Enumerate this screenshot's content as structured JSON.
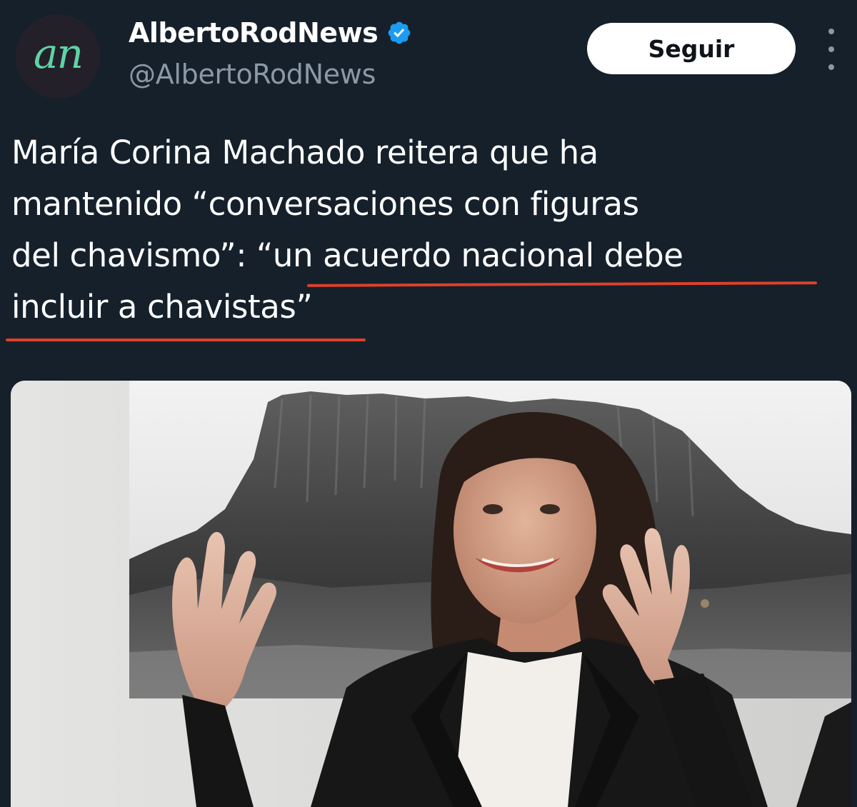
{
  "tweet": {
    "account": {
      "avatar_text": "an",
      "display_name": "AlbertoRodNews",
      "handle": "@AlbertoRodNews",
      "verified": true,
      "verified_color": "#1d9bf0"
    },
    "follow_button_label": "Seguir",
    "headline_lines": [
      "María Corina Machado reitera que ha",
      "mantenido “conversaciones con figuras",
      "del chavismo”: “un acuerdo nacional debe",
      "incluir a chavistas”"
    ]
  },
  "colors": {
    "background": "#15202b",
    "secondary_text": "#8b98a5",
    "underline": "#e0402a",
    "avatar_accent": "#5fd3a4"
  },
  "icons": {
    "verified": "verified-badge-icon",
    "more": "more-options-icon"
  }
}
